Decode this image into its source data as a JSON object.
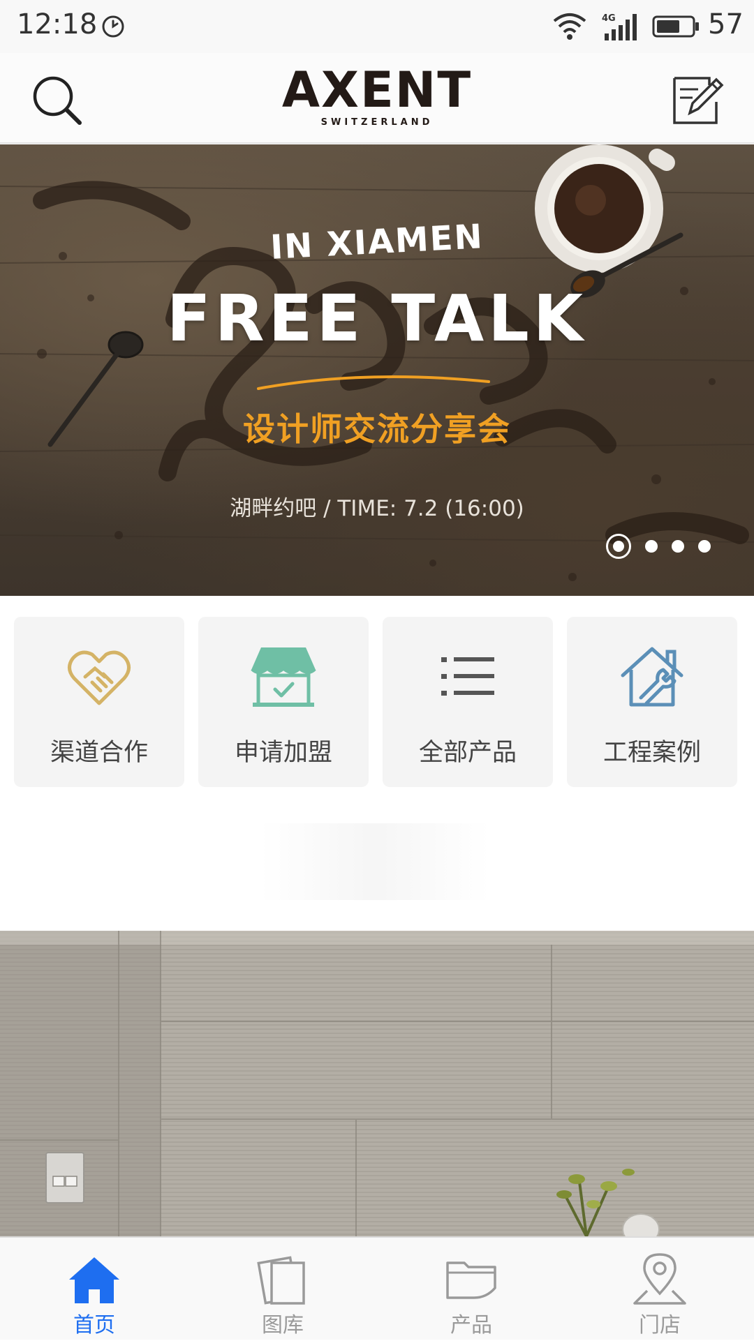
{
  "status_bar": {
    "time": "12:18",
    "network": "4G",
    "battery": "57",
    "icons": [
      "clock-icon",
      "wifi-icon",
      "signal-icon",
      "battery-icon"
    ]
  },
  "header": {
    "brand": "AXENT",
    "brand_sub": "SWITZERLAND",
    "left_icon": "search-icon",
    "right_icon": "edit-icon"
  },
  "banner": {
    "subtitle": "IN XIAMEN",
    "title": "FREE TALK",
    "cn_title": "设计师交流分享会",
    "info": "湖畔约吧 / TIME: 7.2 (16:00)",
    "slide_count": 4,
    "active_slide": 1,
    "accent_color": "#f0a023"
  },
  "quick_entries": [
    {
      "label": "渠道合作",
      "icon": "handshake-heart-icon",
      "color": "#d4b366"
    },
    {
      "label": "申请加盟",
      "icon": "storefront-check-icon",
      "color": "#6fbfa5"
    },
    {
      "label": "全部产品",
      "icon": "list-icon",
      "color": "#555555"
    },
    {
      "label": "工程案例",
      "icon": "house-wrench-icon",
      "color": "#5b8fb7"
    }
  ],
  "bottom_nav": {
    "active_color": "#1e6ef0",
    "inactive_color": "#9a9a9a",
    "items": [
      {
        "label": "首页",
        "icon": "home-icon",
        "active": true
      },
      {
        "label": "图库",
        "icon": "gallery-icon",
        "active": false
      },
      {
        "label": "产品",
        "icon": "product-folder-icon",
        "active": false
      },
      {
        "label": "门店",
        "icon": "location-pin-icon",
        "active": false
      }
    ]
  }
}
